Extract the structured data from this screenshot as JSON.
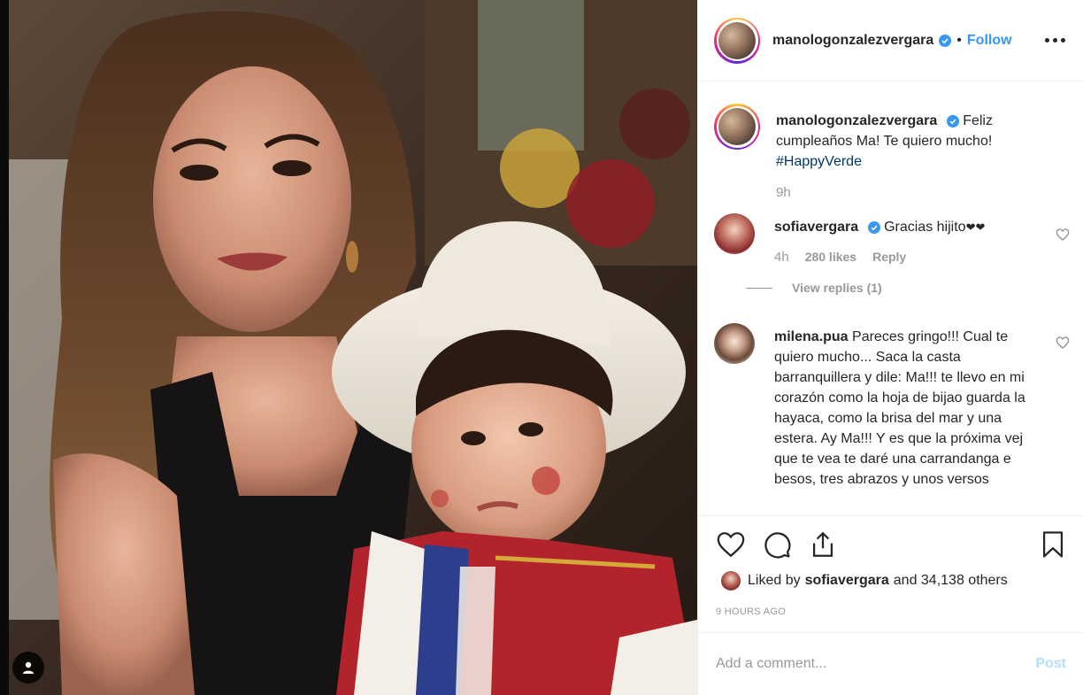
{
  "post": {
    "author": "manologonzalezvergara",
    "follow_label": "Follow",
    "separator": "•"
  },
  "caption": {
    "username": "manologonzalezvergara",
    "text": "Feliz cumpleaños Ma! Te quiero mucho!",
    "hashtag": "#HappyVerde",
    "time": "9h"
  },
  "comments": [
    {
      "username": "sofiavergara",
      "verified": true,
      "text": "Gracias hijito",
      "emoji": "❤❤",
      "time": "4h",
      "likes": "280 likes",
      "reply_label": "Reply",
      "view_replies": "View replies (1)"
    },
    {
      "username": "milena.pua",
      "verified": false,
      "text": "Pareces gringo!!! Cual te quiero mucho... Saca la casta barranquillera y dile: Ma!!! te llevo en mi corazón como la hoja de bijao guarda la hayaca, como la brisa del mar y una estera. Ay Ma!!! Y es que la próxima vej que te vea te daré una carrandanga e besos, tres abrazos y unos versos"
    }
  ],
  "engagement": {
    "liked_by_prefix": "Liked by",
    "liked_by_user": "sofiavergara",
    "liked_by_suffix": "and 34,138 others",
    "timestamp": "9 HOURS AGO"
  },
  "comment_input": {
    "placeholder": "Add a comment...",
    "post_label": "Post"
  },
  "icons": {
    "verified": "verified-badge-icon",
    "more": "more-options-icon",
    "like": "heart-icon",
    "comment": "comment-icon",
    "share": "share-icon",
    "save": "bookmark-icon",
    "tag": "user-tag-icon"
  },
  "colors": {
    "link": "#3897f0",
    "muted": "#999999",
    "hashtag": "#003569",
    "post_disabled": "#b2dffc"
  }
}
